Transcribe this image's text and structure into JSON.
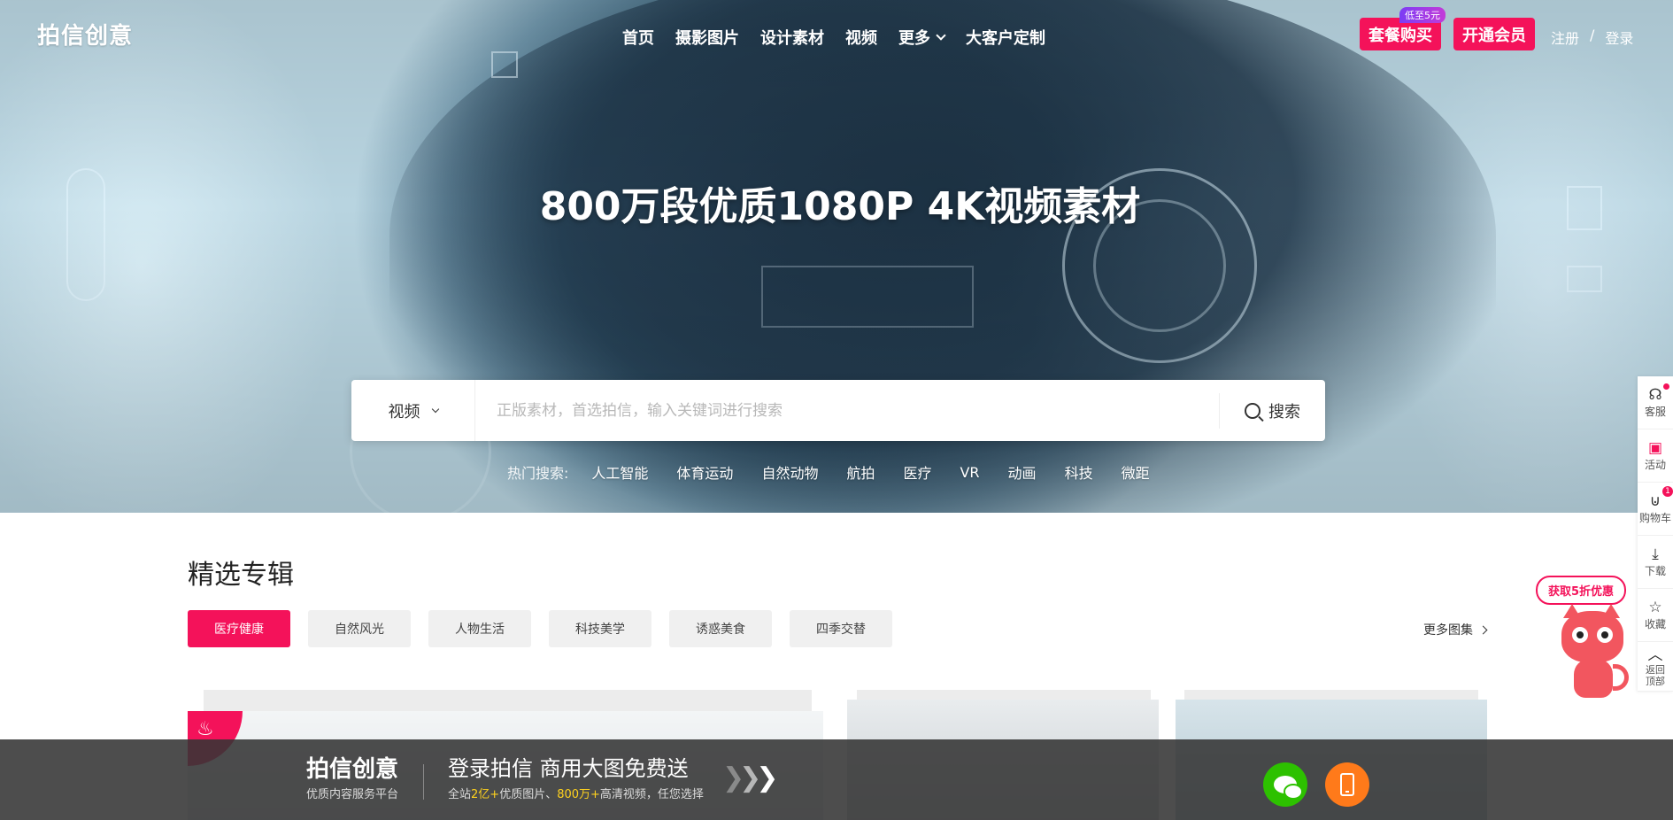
{
  "header": {
    "logo": "拍信创意",
    "nav": [
      "首页",
      "摄影图片",
      "设计素材",
      "视频",
      "更多",
      "大客户定制"
    ],
    "package_button": "套餐购买",
    "package_badge": "低至5元",
    "vip_button": "开通会员",
    "register": "注册",
    "separator": "/",
    "login": "登录"
  },
  "hero": {
    "title": "800万段优质1080P 4K视频素材"
  },
  "search": {
    "type": "视频",
    "placeholder": "正版素材，首选拍信，输入关键词进行搜索",
    "button": "搜索",
    "hot_label": "热门搜索:",
    "hot_items": [
      "人工智能",
      "体育运动",
      "自然动物",
      "航拍",
      "医疗",
      "VR",
      "动画",
      "科技",
      "微距"
    ]
  },
  "section": {
    "title": "精选专辑",
    "tabs": [
      "医疗健康",
      "自然风光",
      "人物生活",
      "科技美学",
      "诱惑美食",
      "四季交替"
    ],
    "active_tab": "医疗健康",
    "more": "更多图集"
  },
  "sidebar": {
    "items": [
      {
        "label": "客服",
        "icon": "headset-icon"
      },
      {
        "label": "活动",
        "icon": "gift-icon"
      },
      {
        "label": "购物车",
        "icon": "cart-icon",
        "count": "1"
      },
      {
        "label": "下载",
        "icon": "download-icon"
      },
      {
        "label": "收藏",
        "icon": "star-icon"
      },
      {
        "label": "返回顶部",
        "icon": "arrow-up-icon"
      }
    ]
  },
  "promo": {
    "bubble": "获取5折优惠"
  },
  "banner": {
    "logo": "拍信创意",
    "slogan": "优质内容服务平台",
    "headline": "登录拍信 商用大图免费送",
    "sub_prefix": "全站",
    "sub_num1": "2亿+",
    "sub_mid": "优质图片、",
    "sub_num2": "800万+",
    "sub_suffix": "高清视频，任您选择"
  },
  "colors": {
    "accent": "#f4125a",
    "highlight": "#ffd21e",
    "wechat": "#2dc100",
    "phone": "#ff7a1a"
  }
}
